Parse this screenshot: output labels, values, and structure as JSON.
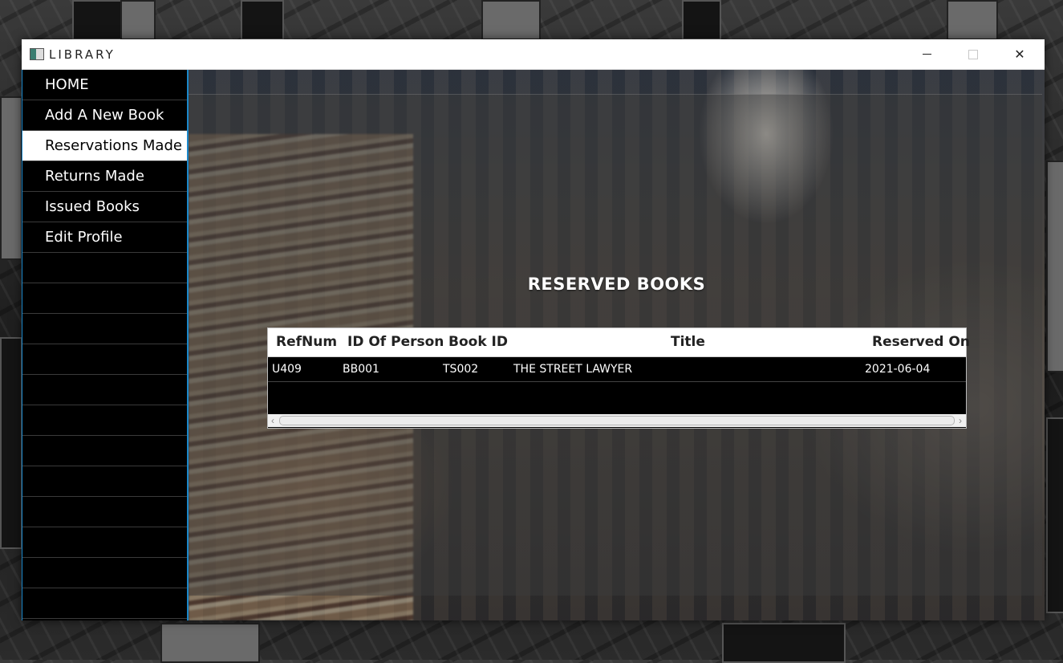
{
  "window": {
    "title": "LIBRARY",
    "minimize_symbol": "",
    "close_symbol": "✕"
  },
  "sidebar": {
    "items": [
      {
        "label": "HOME"
      },
      {
        "label": "Add A New Book"
      },
      {
        "label": "Reservations Made",
        "active": true
      },
      {
        "label": "Returns Made"
      },
      {
        "label": "Issued Books"
      },
      {
        "label": "Edit Profile"
      }
    ]
  },
  "main": {
    "heading": "RESERVED BOOKS",
    "table": {
      "columns": [
        "RefNum",
        "ID Of Person",
        "Book ID",
        "Title",
        "Reserved On"
      ],
      "rows": [
        [
          "U409",
          "BB001",
          "TS002",
          "THE STREET LAWYER",
          "2021-06-04"
        ]
      ]
    },
    "scrollbar": {
      "left_arrow": "‹",
      "right_arrow": "›"
    }
  },
  "colors": {
    "accent": "#1b87c9",
    "sidebar_bg": "#000000",
    "active_item_bg": "#ffffff"
  }
}
